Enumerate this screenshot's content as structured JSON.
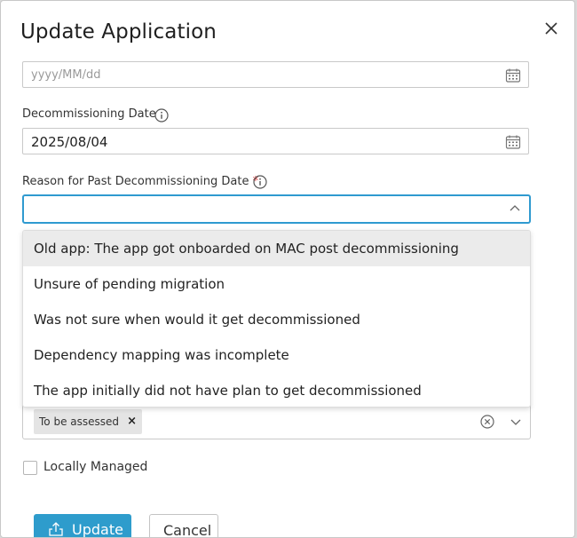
{
  "dialog": {
    "title": "Update Application",
    "close_icon": "close-icon"
  },
  "first_date": {
    "placeholder": "yyyy/MM/dd",
    "icon": "calendar-icon"
  },
  "decommissioning_date": {
    "label": "Decommissioning Date",
    "value": "2025/08/04",
    "info_icon": "info-icon",
    "icon": "calendar-icon"
  },
  "reason": {
    "label": "Reason for Past Decommissioning Date",
    "required_marker": "*",
    "info_icon": "info-icon",
    "value": "",
    "options": [
      "Old app: The app got onboarded on MAC post decommissioning",
      "Unsure of pending migration",
      "Was not sure when would it get decommissioned",
      "Dependency mapping was incomplete",
      "The app initially did not have plan to get decommissioned"
    ],
    "highlighted_index": 0
  },
  "status_select": {
    "chip_label": "To be assessed",
    "chip_remove": "×"
  },
  "locally_managed": {
    "label": "Locally Managed",
    "checked": false
  },
  "buttons": {
    "update_label": "Update",
    "cancel_label": "Cancel"
  },
  "colors": {
    "accent": "#2e9ccc",
    "focus_border": "#2f9ad0",
    "required": "#d32f2f",
    "highlight": "#ebebeb"
  }
}
